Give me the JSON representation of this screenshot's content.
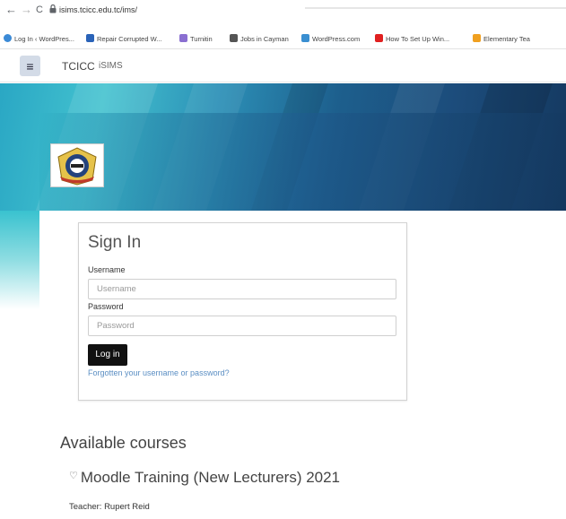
{
  "browser": {
    "back": "←",
    "forward": "→",
    "reload": "C",
    "url": "isims.tcicc.edu.tc/ims/",
    "bookmarks": [
      {
        "label": "Log In ‹ WordPres...",
        "color": "#3b8ad6"
      },
      {
        "label": "Repair Corrupted W...",
        "color": "#2a63b8"
      },
      {
        "label": "Turnitin",
        "color": "#8a6fd1"
      },
      {
        "label": "Jobs in Cayman",
        "color": "#555555"
      },
      {
        "label": "WordPress.com",
        "color": "#3a8fd1"
      },
      {
        "label": "How To Set Up Win...",
        "color": "#e02020"
      },
      {
        "label": "Elementary Tea",
        "color": "#f0a020"
      }
    ]
  },
  "navbar": {
    "menu_icon": "≡",
    "brand": "TCICC",
    "site": "iSIMS"
  },
  "login": {
    "title": "Sign In",
    "username_label": "Username",
    "username_placeholder": "Username",
    "password_label": "Password",
    "password_placeholder": "Password",
    "login_button": "Log in",
    "forgot_link": "Forgotten your username or password?"
  },
  "courses": {
    "heading": "Available courses",
    "items": [
      {
        "name": "Moodle Training (New Lecturers) 2021",
        "teacher": "Teacher: Rupert Reid"
      }
    ]
  },
  "colors": {
    "banner_light": "#43c2cf",
    "banner_dark": "#14385f",
    "link": "#5a8ec3",
    "button": "#111111"
  }
}
